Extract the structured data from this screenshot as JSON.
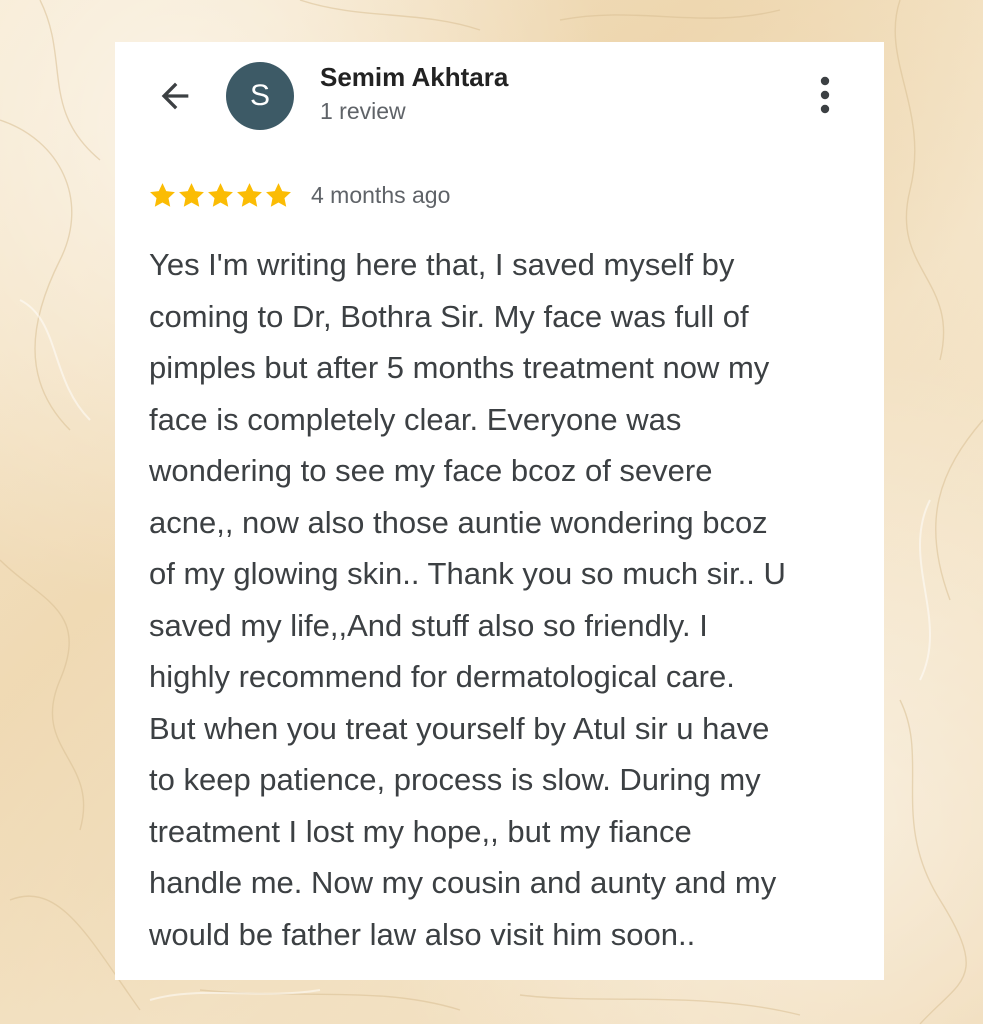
{
  "header": {
    "back_icon": "arrow-left-icon",
    "avatar_initial": "S",
    "avatar_color": "#3d5a66",
    "reviewer_name": "Semim Akhtara",
    "review_count": "1 review",
    "menu_icon": "more-vertical-icon"
  },
  "review": {
    "rating": 5,
    "max_rating": 5,
    "star_color": "#fbbc04",
    "time_ago": "4 months ago",
    "lines": [
      "Yes I'm writing here that, I saved myself by",
      "coming to Dr, Bothra Sir. My face was full of",
      "pimples but after 5 months treatment now my",
      "face is completely clear. Everyone was",
      "wondering to see my face bcoz of severe",
      "acne,, now also those auntie wondering bcoz",
      "of my glowing skin.. Thank you so much sir.. U",
      "saved my life,,And stuff also so friendly. I",
      "highly recommend for dermatological care.",
      "But when you treat yourself by Atul sir u have",
      "to keep patience, process is slow. During my",
      "treatment I lost my hope,, but my fiance",
      "handle me. Now my cousin and aunty and my",
      "would be father law also visit him soon.."
    ]
  }
}
